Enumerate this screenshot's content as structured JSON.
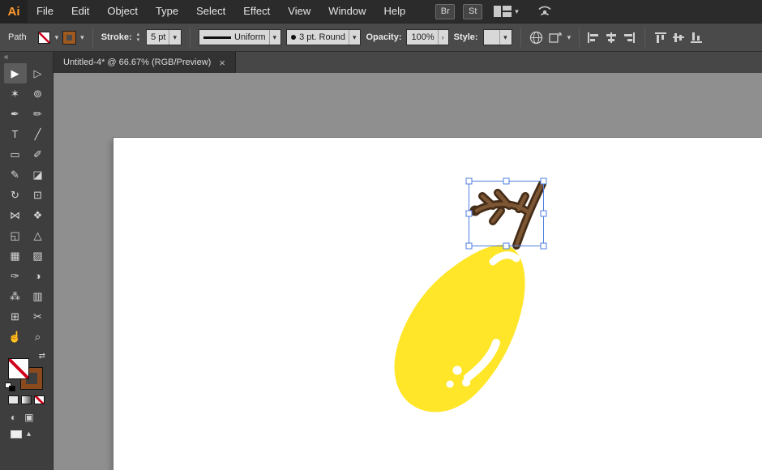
{
  "menu_bar": {
    "logo": "Ai",
    "items": [
      "File",
      "Edit",
      "Object",
      "Type",
      "Select",
      "Effect",
      "View",
      "Window",
      "Help"
    ],
    "bridge_button": "Br",
    "stock_button": "St"
  },
  "control_bar": {
    "selection_label": "Path",
    "stroke_label": "Stroke:",
    "stroke_weight": "5 pt",
    "stroke_profile": "Uniform",
    "brush_definition": "3 pt. Round",
    "opacity_label": "Opacity:",
    "opacity_value": "100%",
    "style_label": "Style:"
  },
  "document_tab": {
    "title": "Untitled-4* @ 66.67% (RGB/Preview)",
    "close_glyph": "×"
  },
  "toolbar": {
    "collapse_glyph": "«",
    "tools": [
      {
        "name": "selection-tool",
        "glyph": "▶"
      },
      {
        "name": "direct-selection-tool",
        "glyph": "▷"
      },
      {
        "name": "magic-wand-tool",
        "glyph": "✶"
      },
      {
        "name": "lasso-tool",
        "glyph": "⊚"
      },
      {
        "name": "pen-tool",
        "glyph": "✒"
      },
      {
        "name": "curvature-tool",
        "glyph": "✏"
      },
      {
        "name": "type-tool",
        "glyph": "T"
      },
      {
        "name": "line-segment-tool",
        "glyph": "╱"
      },
      {
        "name": "rectangle-tool",
        "glyph": "▭"
      },
      {
        "name": "paintbrush-tool",
        "glyph": "✐"
      },
      {
        "name": "shaper-tool",
        "glyph": "✎"
      },
      {
        "name": "eraser-tool",
        "glyph": "◪"
      },
      {
        "name": "rotate-tool",
        "glyph": "↻"
      },
      {
        "name": "scale-tool",
        "glyph": "⊡"
      },
      {
        "name": "width-tool",
        "glyph": "⋈"
      },
      {
        "name": "free-transform-tool",
        "glyph": "❖"
      },
      {
        "name": "shape-builder-tool",
        "glyph": "◱"
      },
      {
        "name": "perspective-grid-tool",
        "glyph": "△"
      },
      {
        "name": "mesh-tool",
        "glyph": "▦"
      },
      {
        "name": "gradient-tool",
        "glyph": "▧"
      },
      {
        "name": "eyedropper-tool",
        "glyph": "✑"
      },
      {
        "name": "blend-tool",
        "glyph": "◑"
      },
      {
        "name": "symbol-sprayer-tool",
        "glyph": "⁂"
      },
      {
        "name": "column-graph-tool",
        "glyph": "▥"
      },
      {
        "name": "artboard-tool",
        "glyph": "⊞"
      },
      {
        "name": "slice-tool",
        "glyph": "✂"
      },
      {
        "name": "hand-tool",
        "glyph": "☝"
      },
      {
        "name": "zoom-tool",
        "glyph": "⌕"
      }
    ]
  },
  "icons": {
    "caret": "▾",
    "spinner_up": "▴",
    "spinner_down": "▾",
    "chevron_right": "›",
    "swap": "⇄",
    "draw_mode_a": "◐",
    "draw_mode_b": "▣",
    "screen_caret": "▴"
  },
  "artwork": {
    "lemon_fill": "#ffe628",
    "stem_dark": "#452d18",
    "stem_light": "#7d5634",
    "highlight": "#ffffff",
    "selection_color": "#4f7fe0"
  }
}
